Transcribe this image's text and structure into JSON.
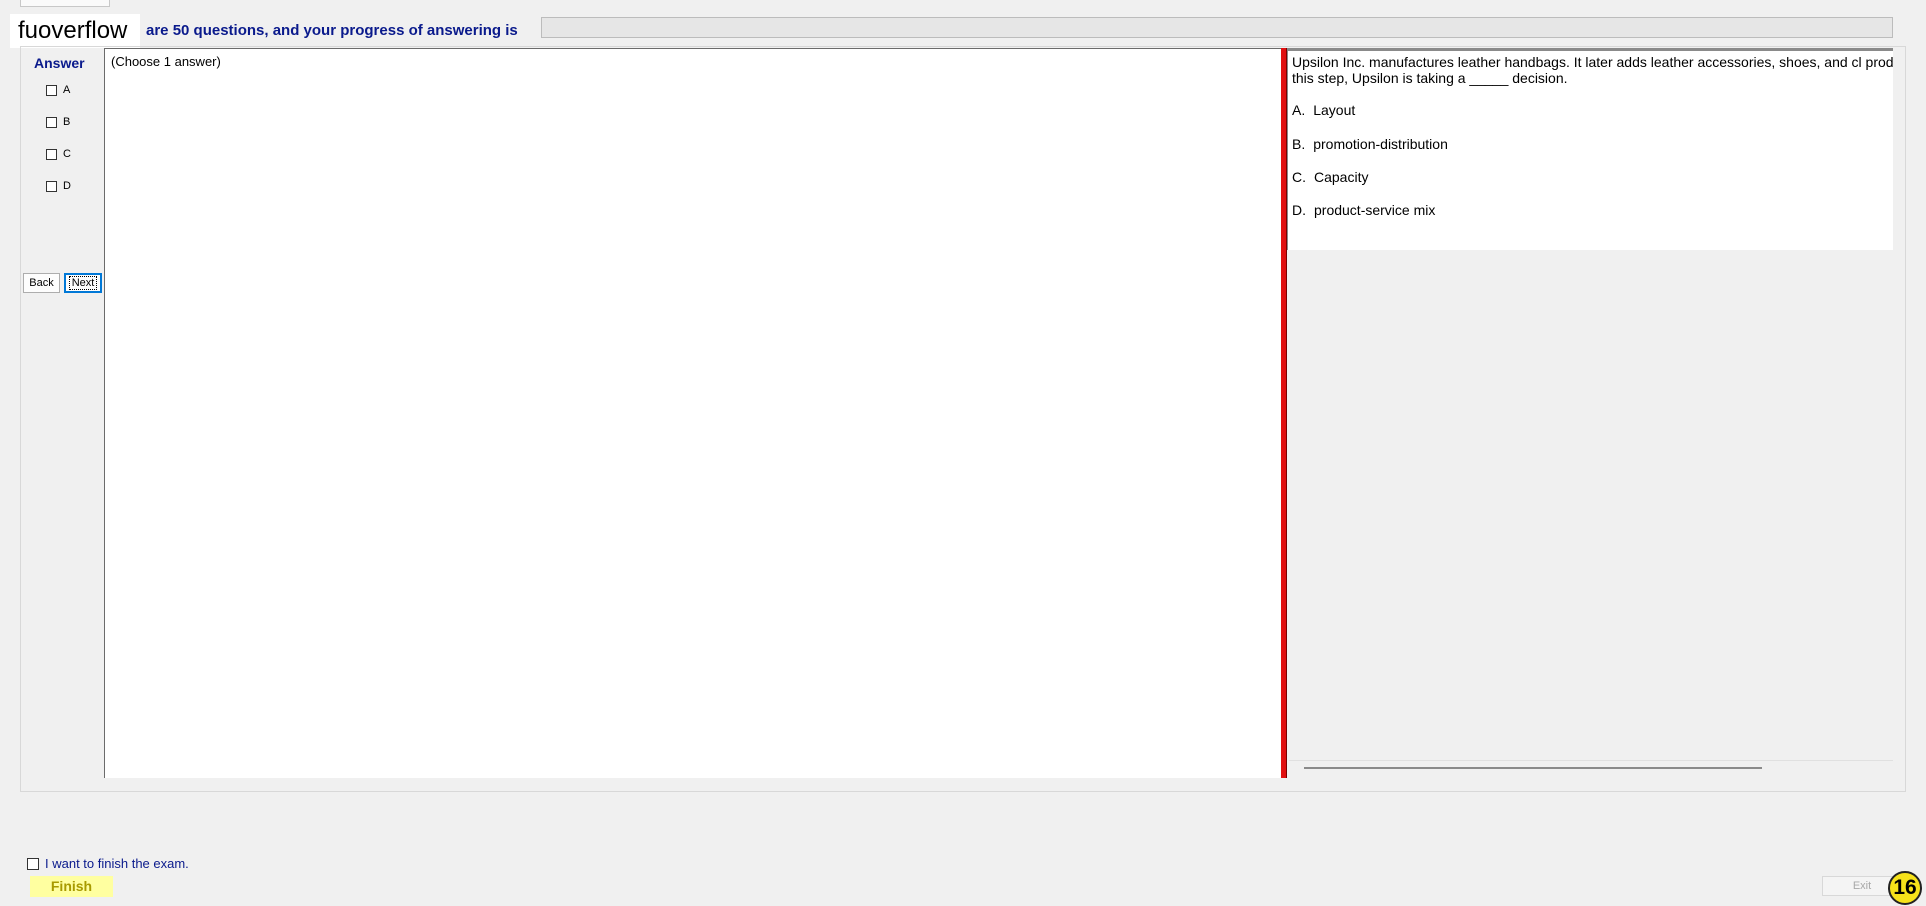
{
  "header": {
    "brand": "fuoverflow",
    "progress_text": "are 50 questions, and your progress of answering is",
    "progress_fraction": 0
  },
  "answer_panel": {
    "title": "Answer",
    "options": [
      "A",
      "B",
      "C",
      "D"
    ],
    "back_label": "Back",
    "next_label": "Next"
  },
  "answer_area": {
    "instruction": "(Choose 1 answer)"
  },
  "question": {
    "text": "Upsilon Inc. manufactures leather handbags. It later adds leather accessories, shoes, and cl production line. With this step, Upsilon is taking a _____ decision.",
    "choices": [
      {
        "letter": "A.",
        "text": "Layout"
      },
      {
        "letter": "B.",
        "text": "promotion-distribution"
      },
      {
        "letter": "C.",
        "text": "Capacity"
      },
      {
        "letter": "D.",
        "text": "product-service mix"
      }
    ]
  },
  "footer": {
    "finish_check_label": "I want to finish the exam.",
    "finish_label": "Finish",
    "exit_label": "Exit",
    "badge": "16"
  },
  "colors": {
    "accent_blue": "#0a1a8c",
    "divider_red": "#e01010",
    "finish_yellow": "#ffffa0",
    "badge_yellow": "#f6e21a"
  }
}
